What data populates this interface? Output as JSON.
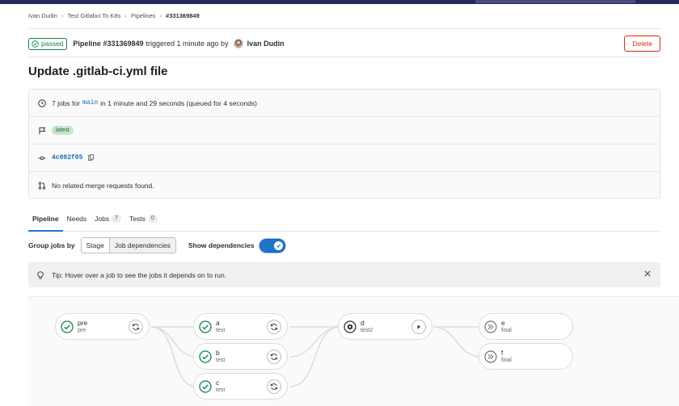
{
  "breadcrumb": [
    "Ivan Dudin",
    "Test Gitlabci To K8s",
    "Pipelines",
    "#331369849"
  ],
  "header": {
    "status": "passed",
    "pipeline_title": "Pipeline #331369849",
    "triggered_text": "triggered 1 minute ago by",
    "author": "Ivan Dudin",
    "delete_label": "Delete"
  },
  "title": "Update .gitlab-ci.yml file",
  "info": {
    "jobs_prefix": "7 jobs for",
    "branch": "main",
    "jobs_suffix": "in 1 minute and 29 seconds (queued for 4 seconds)",
    "tag": "latest",
    "commit": "4c092f05",
    "mr_text": "No related merge requests found."
  },
  "tabs": [
    {
      "label": "Pipeline",
      "count": null
    },
    {
      "label": "Needs",
      "count": null
    },
    {
      "label": "Jobs",
      "count": "7"
    },
    {
      "label": "Tests",
      "count": "0"
    }
  ],
  "grouping": {
    "label": "Group jobs by",
    "options": [
      "Stage",
      "Job dependencies"
    ],
    "selected": "Job dependencies",
    "show_dependencies_label": "Show dependencies",
    "show_dependencies": true
  },
  "tip": "Tip: Hover over a job to see the jobs it depends on to run.",
  "jobs": {
    "pre": {
      "name": "pre",
      "stage": "pre",
      "status": "success",
      "action": "retry"
    },
    "a": {
      "name": "a",
      "stage": "test",
      "status": "success",
      "action": "retry"
    },
    "b": {
      "name": "b",
      "stage": "test",
      "status": "success",
      "action": "retry"
    },
    "c": {
      "name": "c",
      "stage": "test",
      "status": "success",
      "action": "retry"
    },
    "d": {
      "name": "d",
      "stage": "test2",
      "status": "manual",
      "action": "play"
    },
    "e": {
      "name": "e",
      "stage": "final",
      "status": "skipped",
      "action": null
    },
    "f": {
      "name": "f",
      "stage": "final",
      "status": "skipped",
      "action": null
    }
  },
  "colors": {
    "success": "#108548",
    "accent": "#1f75cb",
    "danger": "#dd2b0e"
  }
}
